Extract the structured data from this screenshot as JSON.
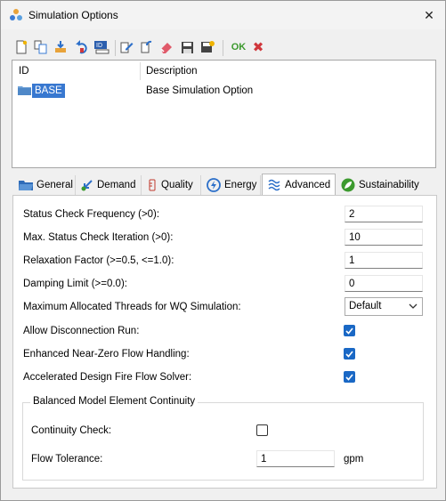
{
  "window": {
    "title": "Simulation Options",
    "close_glyph": "✕"
  },
  "toolbar": {
    "icons": [
      "new-icon",
      "duplicate-icon",
      "import-icon",
      "undo-icon",
      "id-label-icon",
      "edit-icon",
      "rename-icon",
      "delete-icon",
      "save-icon",
      "save-as-icon"
    ],
    "ok_label": "OK",
    "cancel_glyph": "✖"
  },
  "list": {
    "columns": [
      "ID",
      "Description"
    ],
    "rows": [
      {
        "id": "BASE",
        "description": "Base Simulation Option"
      }
    ]
  },
  "tabs": [
    {
      "label": "General",
      "icon": "folder-icon"
    },
    {
      "label": "Demand",
      "icon": "demand-icon"
    },
    {
      "label": "Quality",
      "icon": "beaker-icon"
    },
    {
      "label": "Energy",
      "icon": "energy-icon"
    },
    {
      "label": "Advanced",
      "icon": "advanced-icon"
    },
    {
      "label": "Sustainability",
      "icon": "leaf-icon"
    }
  ],
  "active_tab": "Advanced",
  "advanced": {
    "status_check_frequency": {
      "label": "Status Check Frequency (>0):",
      "value": "2"
    },
    "max_status_check_iteration": {
      "label": "Max. Status Check Iteration (>0):",
      "value": "10"
    },
    "relaxation_factor": {
      "label": "Relaxation Factor (>=0.5, <=1.0):",
      "value": "1"
    },
    "damping_limit": {
      "label": "Damping Limit (>=0.0):",
      "value": "0"
    },
    "max_threads": {
      "label": "Maximum Allocated Threads for WQ Simulation:",
      "value": "Default"
    },
    "allow_disconnection_run": {
      "label": "Allow Disconnection Run:",
      "checked": true
    },
    "enhanced_near_zero": {
      "label": "Enhanced Near-Zero Flow Handling:",
      "checked": true
    },
    "accelerated_fire_flow": {
      "label": "Accelerated Design Fire Flow Solver:",
      "checked": true
    }
  },
  "balanced_group": {
    "title": "Balanced Model Element Continuity",
    "continuity_check": {
      "label": "Continuity Check:",
      "checked": false
    },
    "flow_tolerance": {
      "label": "Flow Tolerance:",
      "value": "1",
      "unit": "gpm"
    }
  },
  "colors": {
    "accent": "#1a68c5",
    "selection": "#3878d0",
    "ok": "#3c9a2e",
    "cancel": "#d0373c"
  }
}
